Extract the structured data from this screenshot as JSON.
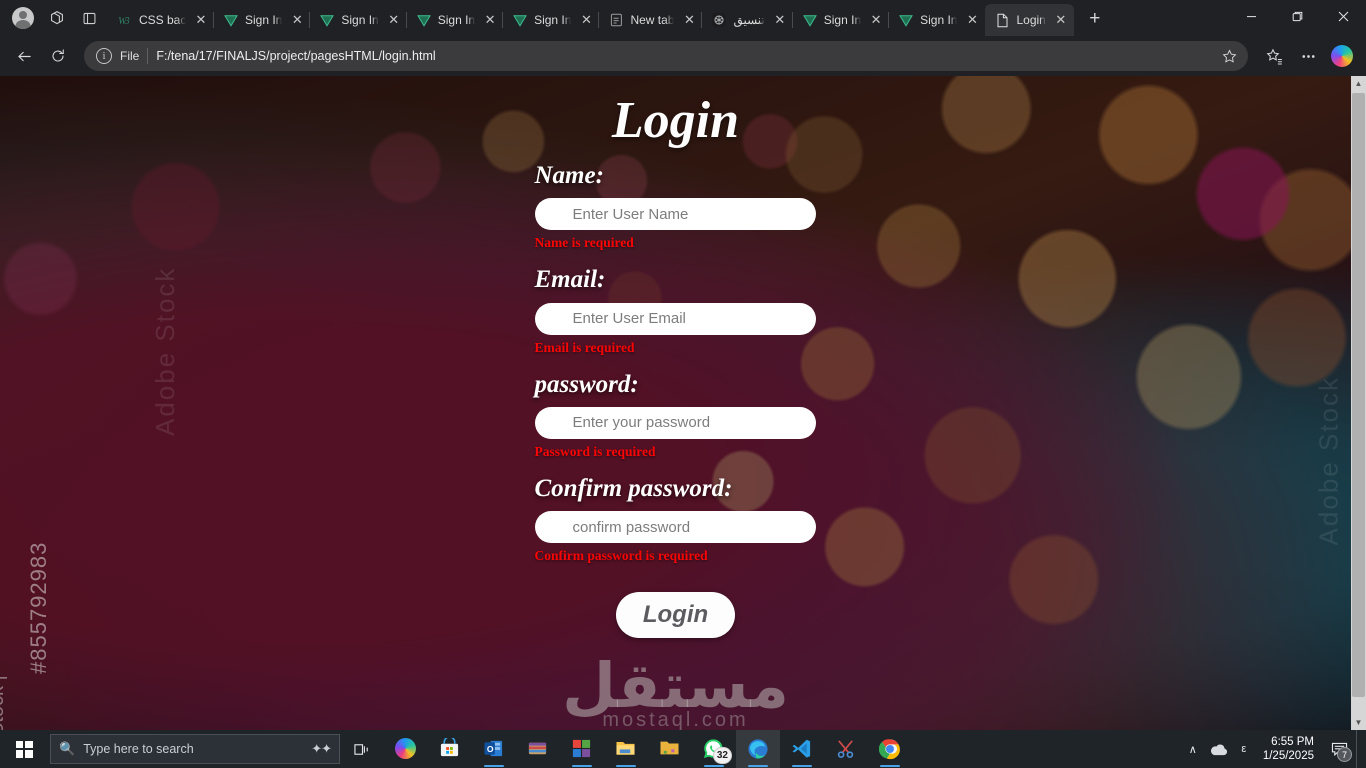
{
  "browser": {
    "tabs": [
      {
        "title": "CSS bac",
        "favicon": "w3schools-icon",
        "active": false
      },
      {
        "title": "Sign In",
        "favicon": "vercel-icon",
        "active": false
      },
      {
        "title": "Sign In",
        "favicon": "vercel-icon",
        "active": false
      },
      {
        "title": "Sign In",
        "favicon": "vercel-icon",
        "active": false
      },
      {
        "title": "Sign In",
        "favicon": "vercel-icon",
        "active": false
      },
      {
        "title": "New tab",
        "favicon": "new-tab-icon",
        "active": false
      },
      {
        "title": "تنسيق",
        "favicon": "chatgpt-icon",
        "active": false,
        "rtl": true
      },
      {
        "title": "Sign In",
        "favicon": "vercel-icon",
        "active": false
      },
      {
        "title": "Sign In",
        "favicon": "vercel-icon",
        "active": false
      },
      {
        "title": "Login",
        "favicon": "file-document-icon",
        "active": true
      }
    ],
    "new_tab_label": "+",
    "window_controls": {
      "minimize": "─",
      "maximize": "❐",
      "close": "✕"
    },
    "toolbar": {
      "back": "←",
      "refresh": "↻",
      "scheme_label": "File",
      "url": "F:/tena/17/FINALJS/project/pagesHTML/login.html",
      "info_icon_label": "i",
      "favorite_icon": "star-icon",
      "collections_icon": "collections-icon",
      "settings_icon": "more-options-icon",
      "copilot_icon": "copilot-icon"
    }
  },
  "page": {
    "title": "Login",
    "fields": [
      {
        "label": "Name:",
        "placeholder": "Enter User Name",
        "value": "",
        "error": "Name is required",
        "name": "username"
      },
      {
        "label": "Email:",
        "placeholder": "Enter User Email",
        "value": "",
        "error": "Email is required",
        "name": "email"
      },
      {
        "label": "password:",
        "placeholder": "Enter your password",
        "value": "",
        "error": "Password is required",
        "name": "password"
      },
      {
        "label": "Confirm password:",
        "placeholder": "confirm password",
        "value": "",
        "error": "Confirm password is required",
        "name": "confirm-password"
      }
    ],
    "submit_label": "Login",
    "watermarks": {
      "adobe_stock_id": "#855792983",
      "adobe_stock_left": "Stock |",
      "adobe_stock_brand": "Adobe Stock",
      "mostaql": "مستقل",
      "mostaql_sub": "mostaql.com"
    },
    "error_color": "#fa0505",
    "accent_color": "#ffffff"
  },
  "taskbar": {
    "start_label": "start-button",
    "search_placeholder": "Type here to search",
    "task_view": "task-view-icon",
    "apps": [
      {
        "name": "copilot",
        "running": false
      },
      {
        "name": "microsoft-store",
        "running": false
      },
      {
        "name": "outlook",
        "running": true
      },
      {
        "name": "winrar",
        "running": false
      },
      {
        "name": "office",
        "running": true
      },
      {
        "name": "file-explorer",
        "running": true
      },
      {
        "name": "folder",
        "running": false
      },
      {
        "name": "whatsapp",
        "running": true,
        "badge": "32"
      },
      {
        "name": "microsoft-edge",
        "running": true,
        "active": true
      },
      {
        "name": "visual-studio-code",
        "running": true
      },
      {
        "name": "snipping-tool",
        "running": false
      },
      {
        "name": "google-chrome",
        "running": true
      }
    ],
    "tray": {
      "chevron": "∧",
      "onedrive": "onedrive-icon",
      "language": "ε",
      "time": "6:55 PM",
      "date": "1/25/2025",
      "notification_count": "7"
    }
  }
}
